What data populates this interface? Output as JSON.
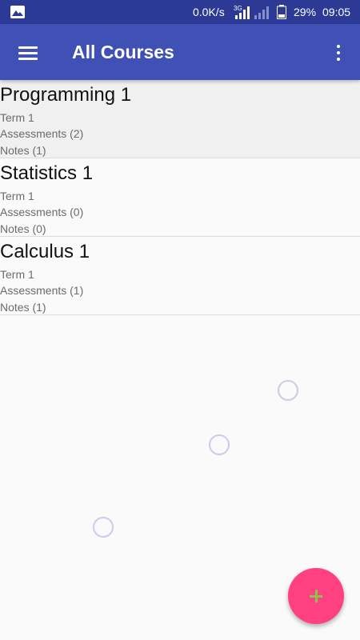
{
  "status_bar": {
    "speed": "0.0K/s",
    "network_label": "3G",
    "battery_pct": "29%",
    "time": "09:05",
    "icons": [
      "gallery-icon",
      "signal-icon",
      "battery-icon"
    ]
  },
  "app_bar": {
    "title": "All Courses",
    "background_color": "#3f51b5",
    "icons": [
      "hamburger-menu-icon",
      "overflow-menu-icon"
    ]
  },
  "courses": [
    {
      "name": "Programming 1",
      "term": "Term 1",
      "assessments": "Assessments (2)",
      "notes": "Notes (1)"
    },
    {
      "name": "Statistics 1",
      "term": "Term 1",
      "assessments": "Assessments (0)",
      "notes": "Notes (0)"
    },
    {
      "name": "Calculus 1",
      "term": "Term 1",
      "assessments": "Assessments (1)",
      "notes": "Notes (1)"
    }
  ],
  "fab": {
    "icon": "plus-icon",
    "color": "#ff4081"
  }
}
